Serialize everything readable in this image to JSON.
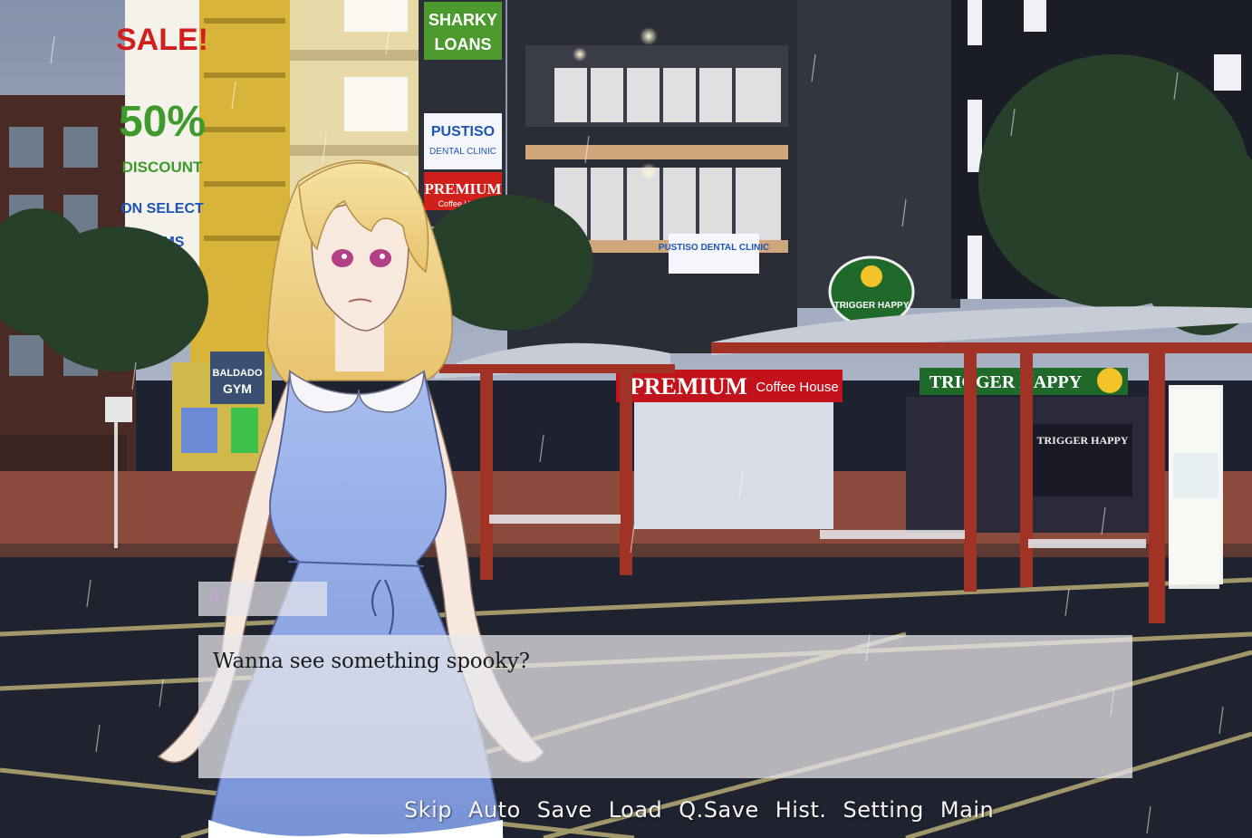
{
  "signs": {
    "sale": "SALE!",
    "discount": "50%",
    "discount_text": "DISCOUNT",
    "on_select": "ON SELECT",
    "items": "ITEMS",
    "sharky1": "SHARKY",
    "sharky2": "LOANS",
    "pustiso1": "PUSTISO",
    "pustiso2": "DENTAL CLINIC",
    "premium_small": "PREMIUM",
    "premium_small_sub": "Coffee House",
    "pustiso_balcony": "PUSTISO DENTAL CLINIC",
    "trigger_round": "TRIGGER HAPPY",
    "premium_big": "PREMIUM",
    "premium_big_sub": "Coffee House",
    "trigger_shop": "TRIGGER HAPPY",
    "trigger_window": "TRIGGER HAPPY",
    "gym1": "BALDADO",
    "gym2": "GYM"
  },
  "dialogue": {
    "speaker": "A",
    "text": "Wanna see something spooky?"
  },
  "menu": {
    "skip": "Skip",
    "auto": "Auto",
    "save": "Save",
    "load": "Load",
    "qsave": "Q.Save",
    "hist": "Hist.",
    "setting": "Setting",
    "main": "Main"
  },
  "colors": {
    "sky": "#6f7d96",
    "street": "#1f2330",
    "sidewalk": "#8a4a3c",
    "shelter_frame": "#a03226",
    "sign_green": "#4c9a2e",
    "sign_blue": "#1d55b4",
    "sign_red": "#d11f1c",
    "dress": "#8fa8e0",
    "hair": "#f1d48a"
  }
}
